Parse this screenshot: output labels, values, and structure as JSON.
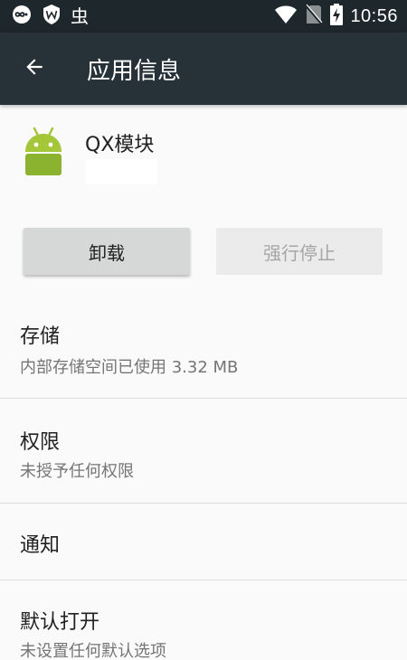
{
  "status_bar": {
    "time": "10:56",
    "bug_glyph": "虫",
    "icons": [
      "infinity-icon",
      "shield-w-icon",
      "wifi-icon",
      "no-sim-icon",
      "battery-charging-icon"
    ]
  },
  "toolbar": {
    "title": "应用信息",
    "back_icon": "arrow-back-icon"
  },
  "app": {
    "name": "QX模块",
    "icon": "android-icon",
    "icon_color": "#a4c639"
  },
  "buttons": {
    "uninstall_label": "卸载",
    "force_stop_label": "强行停止"
  },
  "sections": [
    {
      "title": "存储",
      "summary": "内部存储空间已使用 3.32 MB"
    },
    {
      "title": "权限",
      "summary": "未授予任何权限"
    },
    {
      "title": "通知",
      "summary": ""
    },
    {
      "title": "默认打开",
      "summary": "未设置任何默认选项"
    }
  ],
  "colors": {
    "status_bar": "#1e272c",
    "toolbar": "#263238",
    "background": "#fafafa"
  }
}
